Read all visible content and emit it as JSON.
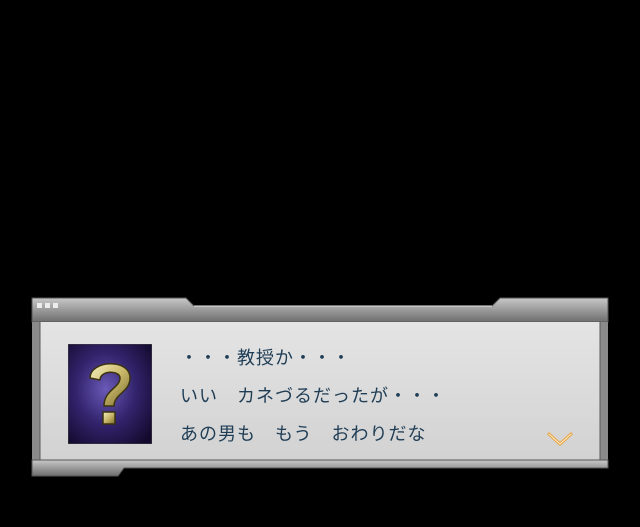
{
  "dialog": {
    "lines": [
      "・・・教授か・・・",
      "いい　カネづるだったが・・・",
      "あの男も　もう　おわりだな"
    ]
  },
  "portrait": {
    "icon": "question-mark-portrait-icon"
  },
  "advance": {
    "icon": "chevron-down-icon",
    "color": "#e8a040"
  },
  "colors": {
    "frame": "#9a9a9a",
    "panel": "#dddddd",
    "text": "#1f3d55",
    "background": "#000000"
  }
}
